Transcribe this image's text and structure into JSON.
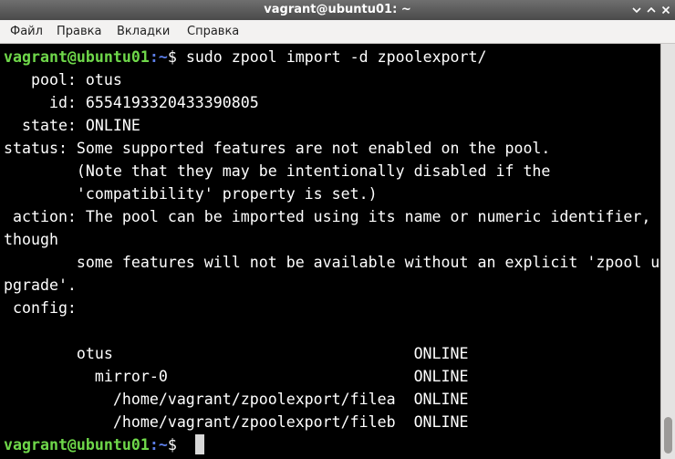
{
  "window": {
    "title": "vagrant@ubuntu01: ~"
  },
  "menubar": {
    "items": [
      "Файл",
      "Правка",
      "Вкладки",
      "Справка"
    ]
  },
  "terminal": {
    "prompt1": {
      "user_host": "vagrant@ubuntu01",
      "path": ":~",
      "symbol": "$ ",
      "command": "sudo zpool import -d zpoolexport/"
    },
    "lines": [
      "   pool: otus",
      "     id: 6554193320433390805",
      "  state: ONLINE",
      "status: Some supported features are not enabled on the pool.",
      "        (Note that they may be intentionally disabled if the",
      "        'compatibility' property is set.)",
      " action: The pool can be imported using its name or numeric identifier,",
      "though",
      "        some features will not be available without an explicit 'zpool u",
      "pgrade'.",
      " config:",
      "",
      "        otus                                 ONLINE",
      "          mirror-0                           ONLINE",
      "            /home/vagrant/zpoolexport/filea  ONLINE",
      "            /home/vagrant/zpoolexport/fileb  ONLINE"
    ],
    "prompt2": {
      "user_host": "vagrant@ubuntu01",
      "path": ":~",
      "symbol": "$ "
    }
  },
  "colors": {
    "prompt_user": "#6fd84a",
    "prompt_path": "#5c7ee8",
    "text": "#ffffff",
    "background": "#000000"
  }
}
